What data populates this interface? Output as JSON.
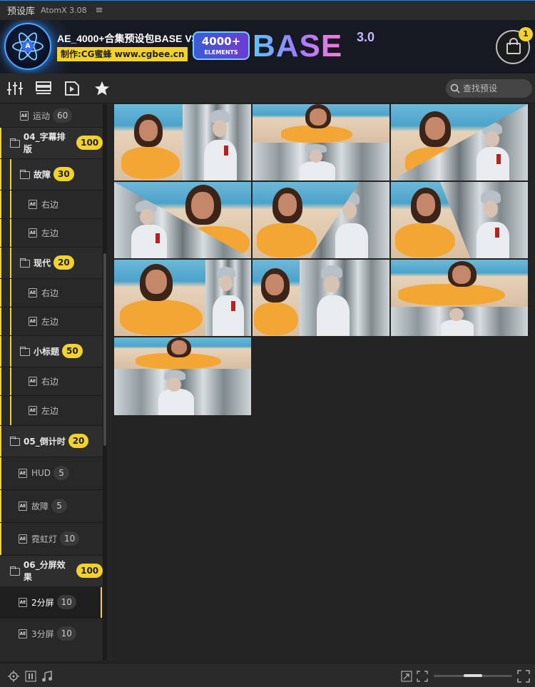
{
  "app": {
    "title": "预设库",
    "version": "AtomX 3.08",
    "menu_glyph": "≡"
  },
  "banner": {
    "title": "AE_4000+合集预设包BASE V3",
    "subtitle": "制作:CG蜜蜂 www.cgbee.cn",
    "badge_number": "4000+",
    "badge_word": "ELEMENTS",
    "base_word": "BASE",
    "base_version": "3.0",
    "cart_count": "1",
    "logo_letter": "A"
  },
  "toolbar": {
    "icons": [
      "sliders-icon",
      "list-icon",
      "video-icon",
      "star-icon"
    ],
    "search_placeholder": "查找预设"
  },
  "sidebar": {
    "items": [
      {
        "label": "运动",
        "count": "60"
      },
      {
        "label": "04_字幕排版",
        "count": "100"
      },
      {
        "label": "故障",
        "count": "30"
      },
      {
        "label": "右边"
      },
      {
        "label": "左边"
      },
      {
        "label": "现代",
        "count": "20"
      },
      {
        "label": "右边"
      },
      {
        "label": "左边"
      },
      {
        "label": "小标题",
        "count": "50"
      },
      {
        "label": "右边"
      },
      {
        "label": "左边"
      },
      {
        "label": "05_倒计时",
        "count": "20"
      },
      {
        "label": "HUD",
        "count": "5"
      },
      {
        "label": "故障",
        "count": "5"
      },
      {
        "label": "霓虹灯",
        "count": "10"
      },
      {
        "label": "06_分屏效果",
        "count": "100"
      },
      {
        "label": "2分屏",
        "count": "10"
      },
      {
        "label": "3分屏",
        "count": "10"
      }
    ]
  },
  "grid": {
    "thumbnail_count": 10
  },
  "bottom": {
    "icons": [
      "target-icon",
      "pause-icon",
      "music-icon",
      "compress-icon",
      "expand-icon",
      "grid-small-icon",
      "grid-large-icon"
    ],
    "zoom": 0.5
  },
  "colors": {
    "accent": "#f3d22b",
    "background": "#232323",
    "panel": "#262626"
  }
}
